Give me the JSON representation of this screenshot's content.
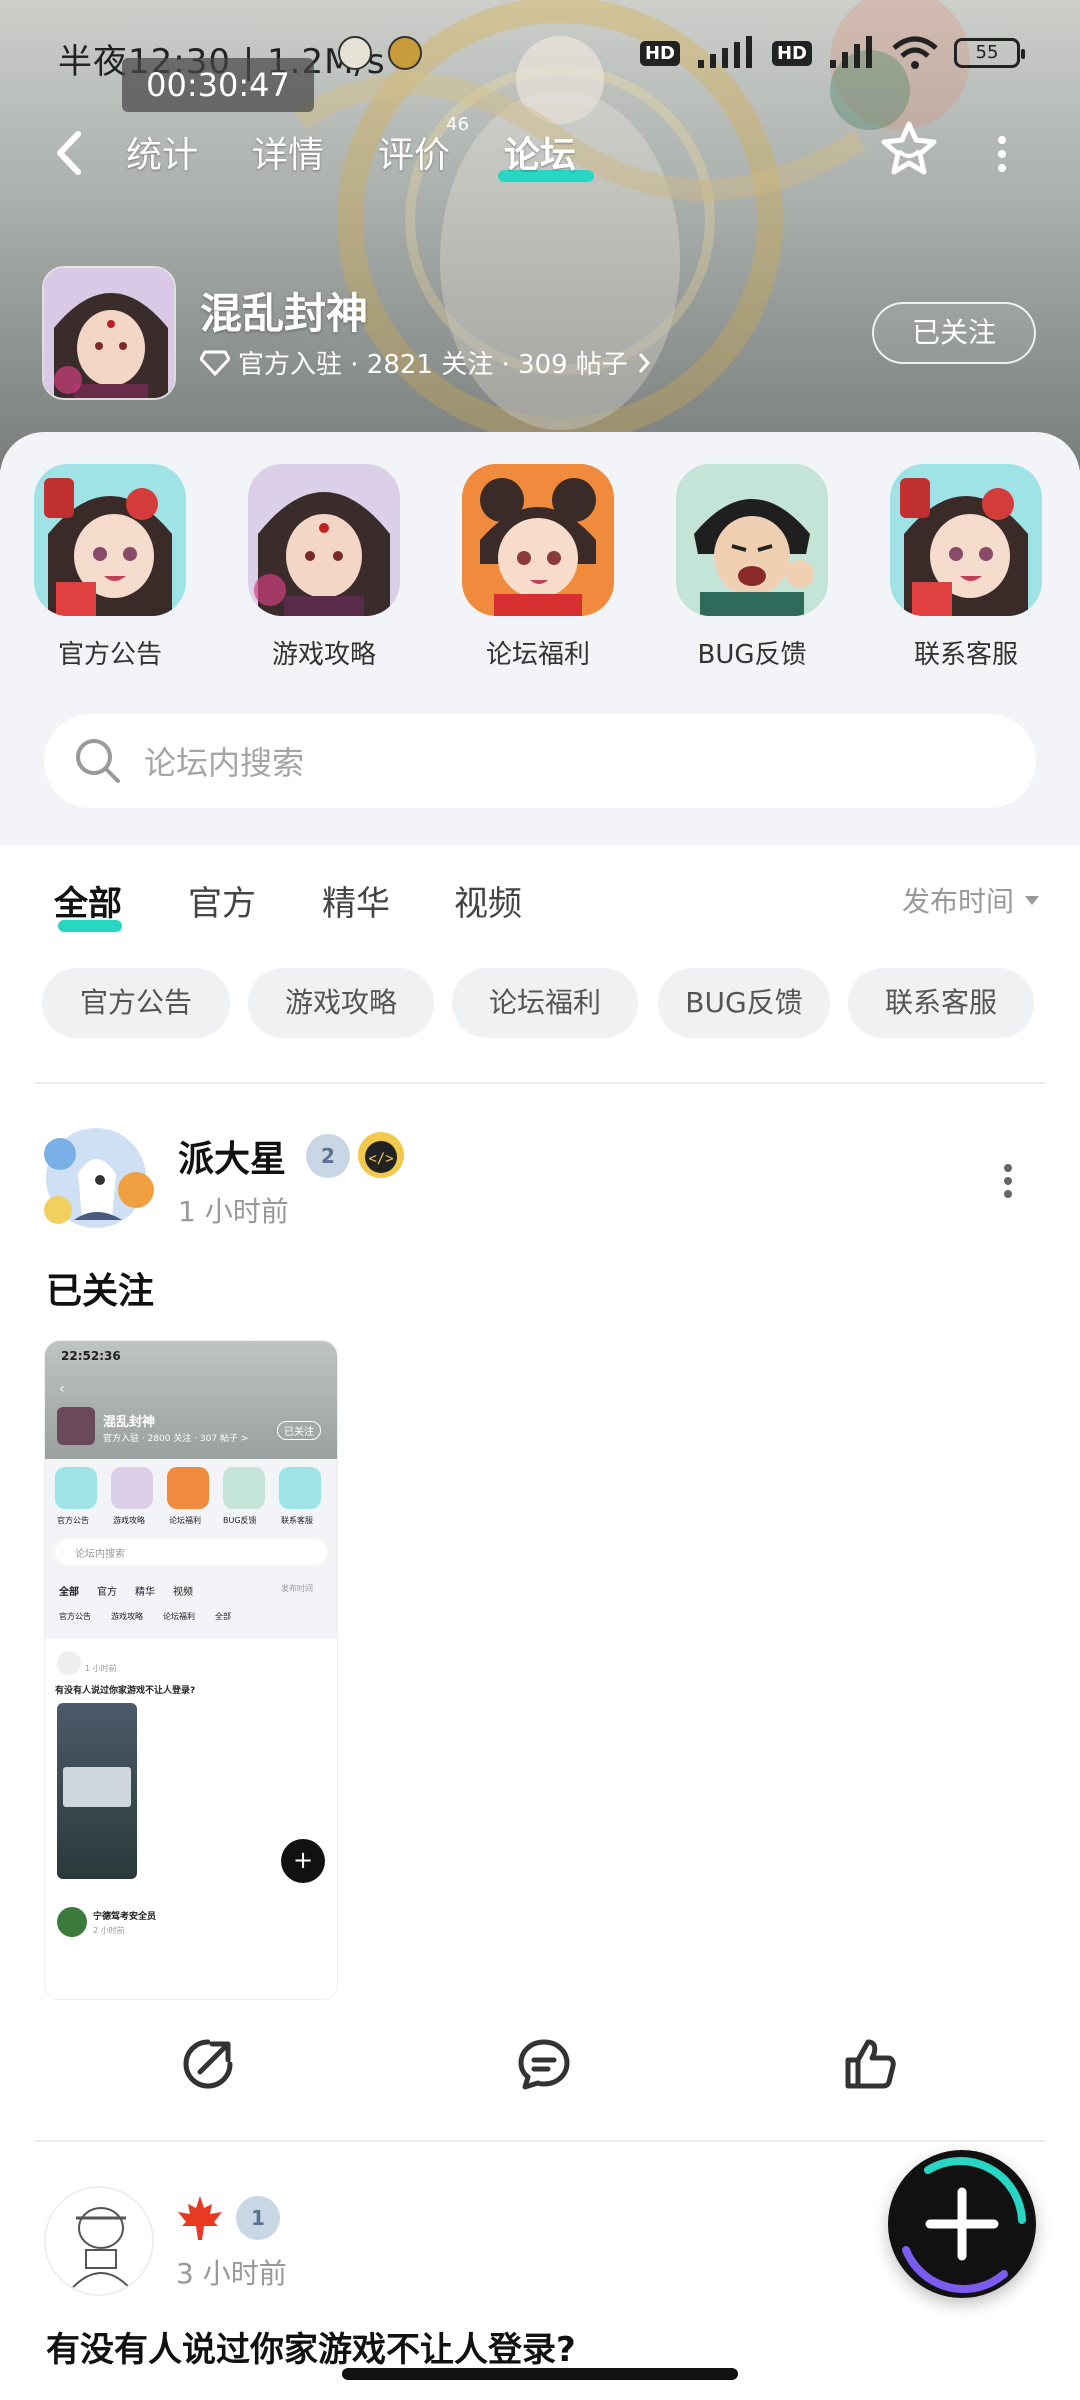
{
  "status_bar": {
    "time": "半夜12:30 | 1.2M/s",
    "hd1": "HD",
    "hd2": "HD",
    "battery": "55"
  },
  "timer": "00:30:47",
  "nav": {
    "tabs": [
      "统计",
      "详情",
      "评价",
      "论坛"
    ],
    "review_count": "46",
    "active_tab": "论坛"
  },
  "game": {
    "title": "混乱封神",
    "meta": "官方入驻 · 2821 关注 · 309 帖子",
    "follow_label": "已关注"
  },
  "categories": [
    {
      "label": "官方公告",
      "icon": "official-announcement-icon"
    },
    {
      "label": "游戏攻略",
      "icon": "game-guide-icon"
    },
    {
      "label": "论坛福利",
      "icon": "forum-welfare-icon"
    },
    {
      "label": "BUG反馈",
      "icon": "bug-feedback-icon"
    },
    {
      "label": "联系客服",
      "icon": "customer-service-icon"
    }
  ],
  "search": {
    "placeholder": "论坛内搜索"
  },
  "feed_tabs": [
    "全部",
    "官方",
    "精华",
    "视频"
  ],
  "sort_label": "发布时间",
  "chips": [
    "官方公告",
    "游戏攻略",
    "论坛福利",
    "BUG反馈",
    "联系客服"
  ],
  "posts": [
    {
      "user": "派大星",
      "level": "2",
      "time": "1 小时前",
      "text": "已关注",
      "image": {
        "status_time": "22:52:36",
        "title": "混乱封神",
        "meta": "官方入驻 · 2800 关注 · 307 帖子 >",
        "follow": "已关注",
        "categories": [
          "官方公告",
          "游戏攻略",
          "论坛福利",
          "BUG反馈",
          "联系客服"
        ],
        "search": "论坛内搜索",
        "tabs": [
          "全部",
          "官方",
          "精华",
          "视频"
        ],
        "sort": "发布时间",
        "chips": [
          "官方公告",
          "游戏攻略",
          "论坛福利",
          "全部"
        ],
        "post_time": "1 小时前",
        "post_text": "有没有人说过你家游戏不让人登录?",
        "next_user": "宁德驾考安全员",
        "next_time": "2 小时前"
      }
    },
    {
      "user": "",
      "level": "1",
      "time": "3 小时前",
      "text": "有没有人说过你家游戏不让人登录?"
    }
  ],
  "colors": {
    "accent": "#28d6c4",
    "panel": "#f3f4f7",
    "chip": "#f0f1f3"
  }
}
